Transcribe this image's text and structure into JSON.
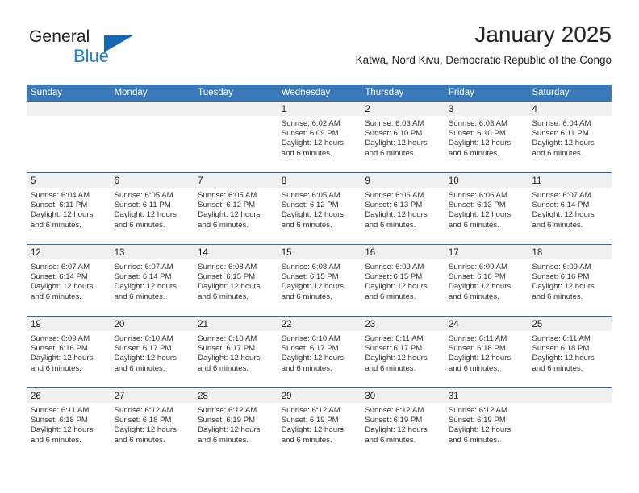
{
  "brand": {
    "name_top": "General",
    "name_bottom": "Blue",
    "triangle_color": "#1668b3",
    "blue_text_color": "#1c7fd4"
  },
  "header": {
    "title": "January 2025",
    "subtitle": "Katwa, Nord Kivu, Democratic Republic of the Congo"
  },
  "theme": {
    "header_blue": "#3a7ab8",
    "row_divider_blue": "#2c6ca8",
    "daynum_band_gray": "#f0f0f0",
    "text_color": "#222222"
  },
  "weekdays": [
    "Sunday",
    "Monday",
    "Tuesday",
    "Wednesday",
    "Thursday",
    "Friday",
    "Saturday"
  ],
  "weeks": [
    [
      {
        "day": "",
        "sunrise": "",
        "sunset": "",
        "daylight_line1": "",
        "daylight_line2": ""
      },
      {
        "day": "",
        "sunrise": "",
        "sunset": "",
        "daylight_line1": "",
        "daylight_line2": ""
      },
      {
        "day": "",
        "sunrise": "",
        "sunset": "",
        "daylight_line1": "",
        "daylight_line2": ""
      },
      {
        "day": "1",
        "sunrise": "Sunrise: 6:02 AM",
        "sunset": "Sunset: 6:09 PM",
        "daylight_line1": "Daylight: 12 hours",
        "daylight_line2": "and 6 minutes."
      },
      {
        "day": "2",
        "sunrise": "Sunrise: 6:03 AM",
        "sunset": "Sunset: 6:10 PM",
        "daylight_line1": "Daylight: 12 hours",
        "daylight_line2": "and 6 minutes."
      },
      {
        "day": "3",
        "sunrise": "Sunrise: 6:03 AM",
        "sunset": "Sunset: 6:10 PM",
        "daylight_line1": "Daylight: 12 hours",
        "daylight_line2": "and 6 minutes."
      },
      {
        "day": "4",
        "sunrise": "Sunrise: 6:04 AM",
        "sunset": "Sunset: 6:11 PM",
        "daylight_line1": "Daylight: 12 hours",
        "daylight_line2": "and 6 minutes."
      }
    ],
    [
      {
        "day": "5",
        "sunrise": "Sunrise: 6:04 AM",
        "sunset": "Sunset: 6:11 PM",
        "daylight_line1": "Daylight: 12 hours",
        "daylight_line2": "and 6 minutes."
      },
      {
        "day": "6",
        "sunrise": "Sunrise: 6:05 AM",
        "sunset": "Sunset: 6:11 PM",
        "daylight_line1": "Daylight: 12 hours",
        "daylight_line2": "and 6 minutes."
      },
      {
        "day": "7",
        "sunrise": "Sunrise: 6:05 AM",
        "sunset": "Sunset: 6:12 PM",
        "daylight_line1": "Daylight: 12 hours",
        "daylight_line2": "and 6 minutes."
      },
      {
        "day": "8",
        "sunrise": "Sunrise: 6:05 AM",
        "sunset": "Sunset: 6:12 PM",
        "daylight_line1": "Daylight: 12 hours",
        "daylight_line2": "and 6 minutes."
      },
      {
        "day": "9",
        "sunrise": "Sunrise: 6:06 AM",
        "sunset": "Sunset: 6:13 PM",
        "daylight_line1": "Daylight: 12 hours",
        "daylight_line2": "and 6 minutes."
      },
      {
        "day": "10",
        "sunrise": "Sunrise: 6:06 AM",
        "sunset": "Sunset: 6:13 PM",
        "daylight_line1": "Daylight: 12 hours",
        "daylight_line2": "and 6 minutes."
      },
      {
        "day": "11",
        "sunrise": "Sunrise: 6:07 AM",
        "sunset": "Sunset: 6:14 PM",
        "daylight_line1": "Daylight: 12 hours",
        "daylight_line2": "and 6 minutes."
      }
    ],
    [
      {
        "day": "12",
        "sunrise": "Sunrise: 6:07 AM",
        "sunset": "Sunset: 6:14 PM",
        "daylight_line1": "Daylight: 12 hours",
        "daylight_line2": "and 6 minutes."
      },
      {
        "day": "13",
        "sunrise": "Sunrise: 6:07 AM",
        "sunset": "Sunset: 6:14 PM",
        "daylight_line1": "Daylight: 12 hours",
        "daylight_line2": "and 6 minutes."
      },
      {
        "day": "14",
        "sunrise": "Sunrise: 6:08 AM",
        "sunset": "Sunset: 6:15 PM",
        "daylight_line1": "Daylight: 12 hours",
        "daylight_line2": "and 6 minutes."
      },
      {
        "day": "15",
        "sunrise": "Sunrise: 6:08 AM",
        "sunset": "Sunset: 6:15 PM",
        "daylight_line1": "Daylight: 12 hours",
        "daylight_line2": "and 6 minutes."
      },
      {
        "day": "16",
        "sunrise": "Sunrise: 6:09 AM",
        "sunset": "Sunset: 6:15 PM",
        "daylight_line1": "Daylight: 12 hours",
        "daylight_line2": "and 6 minutes."
      },
      {
        "day": "17",
        "sunrise": "Sunrise: 6:09 AM",
        "sunset": "Sunset: 6:16 PM",
        "daylight_line1": "Daylight: 12 hours",
        "daylight_line2": "and 6 minutes."
      },
      {
        "day": "18",
        "sunrise": "Sunrise: 6:09 AM",
        "sunset": "Sunset: 6:16 PM",
        "daylight_line1": "Daylight: 12 hours",
        "daylight_line2": "and 6 minutes."
      }
    ],
    [
      {
        "day": "19",
        "sunrise": "Sunrise: 6:09 AM",
        "sunset": "Sunset: 6:16 PM",
        "daylight_line1": "Daylight: 12 hours",
        "daylight_line2": "and 6 minutes."
      },
      {
        "day": "20",
        "sunrise": "Sunrise: 6:10 AM",
        "sunset": "Sunset: 6:17 PM",
        "daylight_line1": "Daylight: 12 hours",
        "daylight_line2": "and 6 minutes."
      },
      {
        "day": "21",
        "sunrise": "Sunrise: 6:10 AM",
        "sunset": "Sunset: 6:17 PM",
        "daylight_line1": "Daylight: 12 hours",
        "daylight_line2": "and 6 minutes."
      },
      {
        "day": "22",
        "sunrise": "Sunrise: 6:10 AM",
        "sunset": "Sunset: 6:17 PM",
        "daylight_line1": "Daylight: 12 hours",
        "daylight_line2": "and 6 minutes."
      },
      {
        "day": "23",
        "sunrise": "Sunrise: 6:11 AM",
        "sunset": "Sunset: 6:17 PM",
        "daylight_line1": "Daylight: 12 hours",
        "daylight_line2": "and 6 minutes."
      },
      {
        "day": "24",
        "sunrise": "Sunrise: 6:11 AM",
        "sunset": "Sunset: 6:18 PM",
        "daylight_line1": "Daylight: 12 hours",
        "daylight_line2": "and 6 minutes."
      },
      {
        "day": "25",
        "sunrise": "Sunrise: 6:11 AM",
        "sunset": "Sunset: 6:18 PM",
        "daylight_line1": "Daylight: 12 hours",
        "daylight_line2": "and 6 minutes."
      }
    ],
    [
      {
        "day": "26",
        "sunrise": "Sunrise: 6:11 AM",
        "sunset": "Sunset: 6:18 PM",
        "daylight_line1": "Daylight: 12 hours",
        "daylight_line2": "and 6 minutes."
      },
      {
        "day": "27",
        "sunrise": "Sunrise: 6:12 AM",
        "sunset": "Sunset: 6:18 PM",
        "daylight_line1": "Daylight: 12 hours",
        "daylight_line2": "and 6 minutes."
      },
      {
        "day": "28",
        "sunrise": "Sunrise: 6:12 AM",
        "sunset": "Sunset: 6:19 PM",
        "daylight_line1": "Daylight: 12 hours",
        "daylight_line2": "and 6 minutes."
      },
      {
        "day": "29",
        "sunrise": "Sunrise: 6:12 AM",
        "sunset": "Sunset: 6:19 PM",
        "daylight_line1": "Daylight: 12 hours",
        "daylight_line2": "and 6 minutes."
      },
      {
        "day": "30",
        "sunrise": "Sunrise: 6:12 AM",
        "sunset": "Sunset: 6:19 PM",
        "daylight_line1": "Daylight: 12 hours",
        "daylight_line2": "and 6 minutes."
      },
      {
        "day": "31",
        "sunrise": "Sunrise: 6:12 AM",
        "sunset": "Sunset: 6:19 PM",
        "daylight_line1": "Daylight: 12 hours",
        "daylight_line2": "and 6 minutes."
      },
      {
        "day": "",
        "sunrise": "",
        "sunset": "",
        "daylight_line1": "",
        "daylight_line2": ""
      }
    ]
  ]
}
